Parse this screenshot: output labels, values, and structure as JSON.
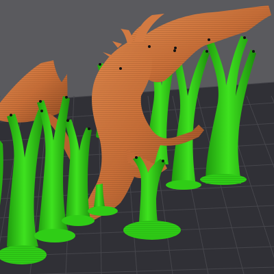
{
  "scene": {
    "viewport": "3d-print-slicer-preview",
    "model": "dragon-figure",
    "support_structure": "tree-supports",
    "colors": {
      "background": "#5a5a5e",
      "build_plate": "#303036",
      "grid_line": "#45454b",
      "model": "#c8703a",
      "model_shadow": "#8f4a22",
      "model_highlight": "#e0874c",
      "support": "#2fcd16",
      "support_shadow": "#1f9a0e",
      "support_highlight": "#5ce63c"
    }
  }
}
